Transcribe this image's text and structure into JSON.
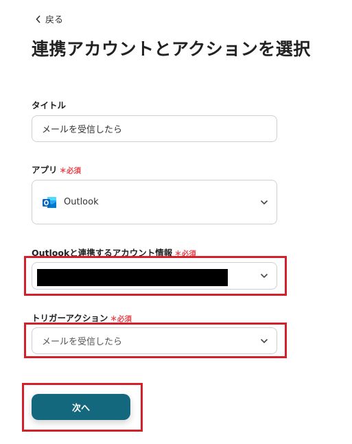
{
  "nav": {
    "back_label": "戻る"
  },
  "page": {
    "title": "連携アカウントとアクションを選択"
  },
  "form": {
    "title_field": {
      "label": "タイトル",
      "value": "メールを受信したら"
    },
    "app_field": {
      "label": "アプリ",
      "required": "＊必須",
      "value": "Outlook"
    },
    "account_field": {
      "label": "Outlookと連携するアカウント情報",
      "required": "＊必須"
    },
    "trigger_field": {
      "label": "トリガーアクション",
      "required": "＊必須",
      "value": "メールを受信したら"
    }
  },
  "actions": {
    "next_label": "次へ"
  },
  "colors": {
    "accent": "#14687e",
    "required": "#e8464e",
    "highlight": "#d3202a"
  },
  "icons": {
    "back": "chevron-left-icon",
    "dropdown": "chevron-down-icon",
    "app": "outlook-icon"
  }
}
